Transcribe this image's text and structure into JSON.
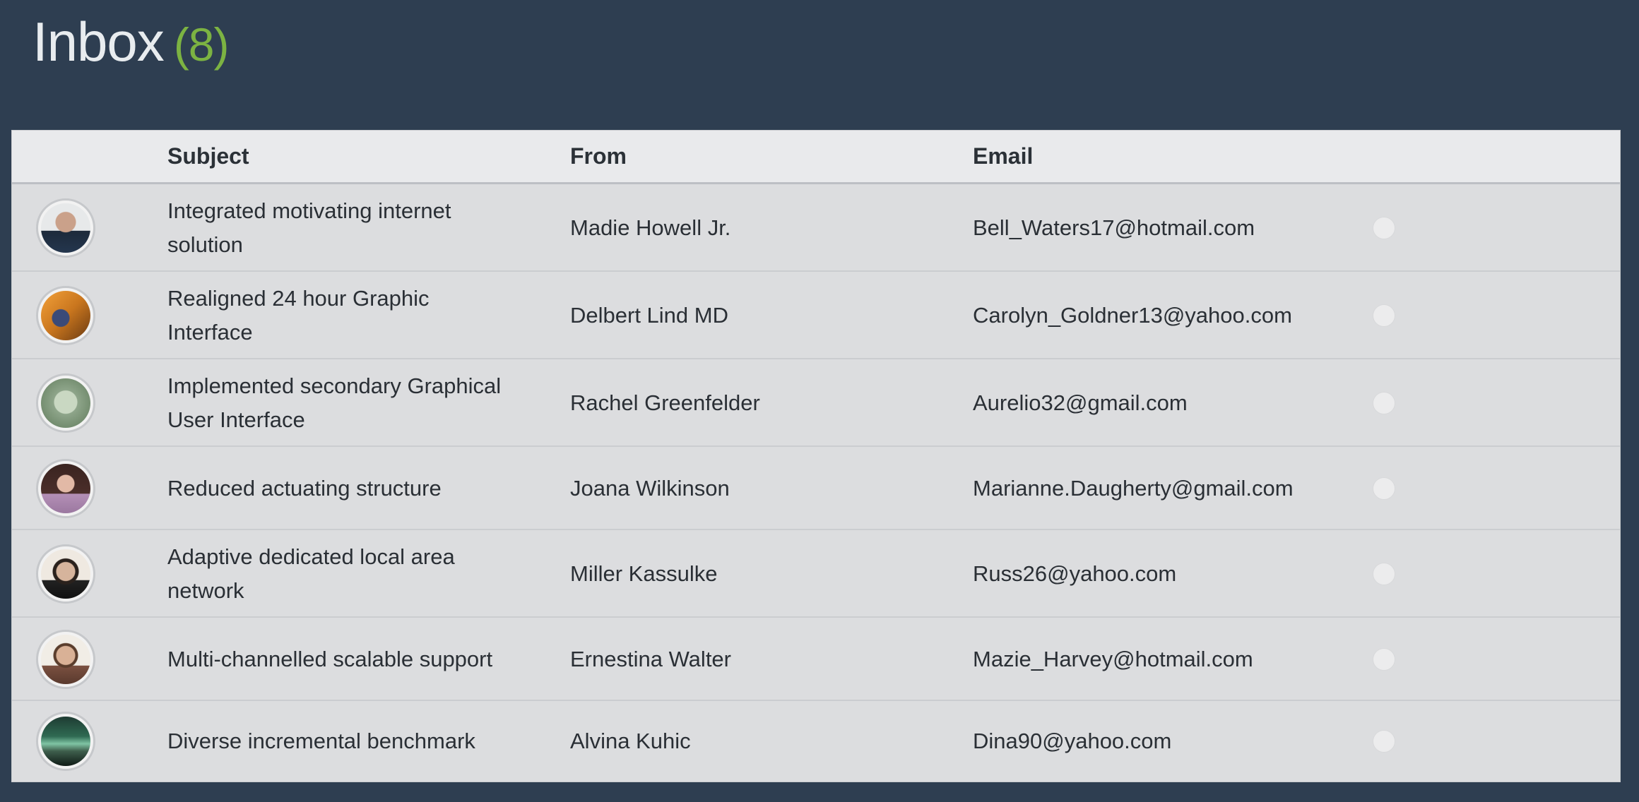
{
  "header": {
    "title": "Inbox",
    "count": "(8)"
  },
  "colors": {
    "background": "#2e3e51",
    "count": "#7cb342",
    "row_bg": "#dcdddf",
    "header_bg": "#e9eaec"
  },
  "table": {
    "columns": {
      "avatar": "",
      "subject": "Subject",
      "from": "From",
      "email": "Email"
    },
    "rows": [
      {
        "subject_line1": "Integrated motivating internet",
        "subject_line2": "solution",
        "from": "Madie Howell Jr.",
        "email": "Bell_Waters17@hotmail.com",
        "avatar_icon": "user-avatar-icon"
      },
      {
        "subject_line1": "Realigned 24 hour Graphic",
        "subject_line2": "Interface",
        "from": "Delbert Lind MD",
        "email": "Carolyn_Goldner13@yahoo.com",
        "avatar_icon": "user-avatar-icon"
      },
      {
        "subject_line1": "Implemented secondary Graphical",
        "subject_line2": "User Interface",
        "from": "Rachel Greenfelder",
        "email": "Aurelio32@gmail.com",
        "avatar_icon": "user-avatar-icon"
      },
      {
        "subject_line1": "Reduced actuating structure",
        "subject_line2": "",
        "from": "Joana Wilkinson",
        "email": "Marianne.Daugherty@gmail.com",
        "avatar_icon": "user-avatar-icon"
      },
      {
        "subject_line1": "Adaptive dedicated local area",
        "subject_line2": "network",
        "from": "Miller Kassulke",
        "email": "Russ26@yahoo.com",
        "avatar_icon": "user-avatar-icon"
      },
      {
        "subject_line1": "Multi-channelled scalable support",
        "subject_line2": "",
        "from": "Ernestina Walter",
        "email": "Mazie_Harvey@hotmail.com",
        "avatar_icon": "user-avatar-icon"
      },
      {
        "subject_line1": "Diverse incremental benchmark",
        "subject_line2": "",
        "from": "Alvina Kuhic",
        "email": "Dina90@yahoo.com",
        "avatar_icon": "user-avatar-icon"
      }
    ]
  }
}
